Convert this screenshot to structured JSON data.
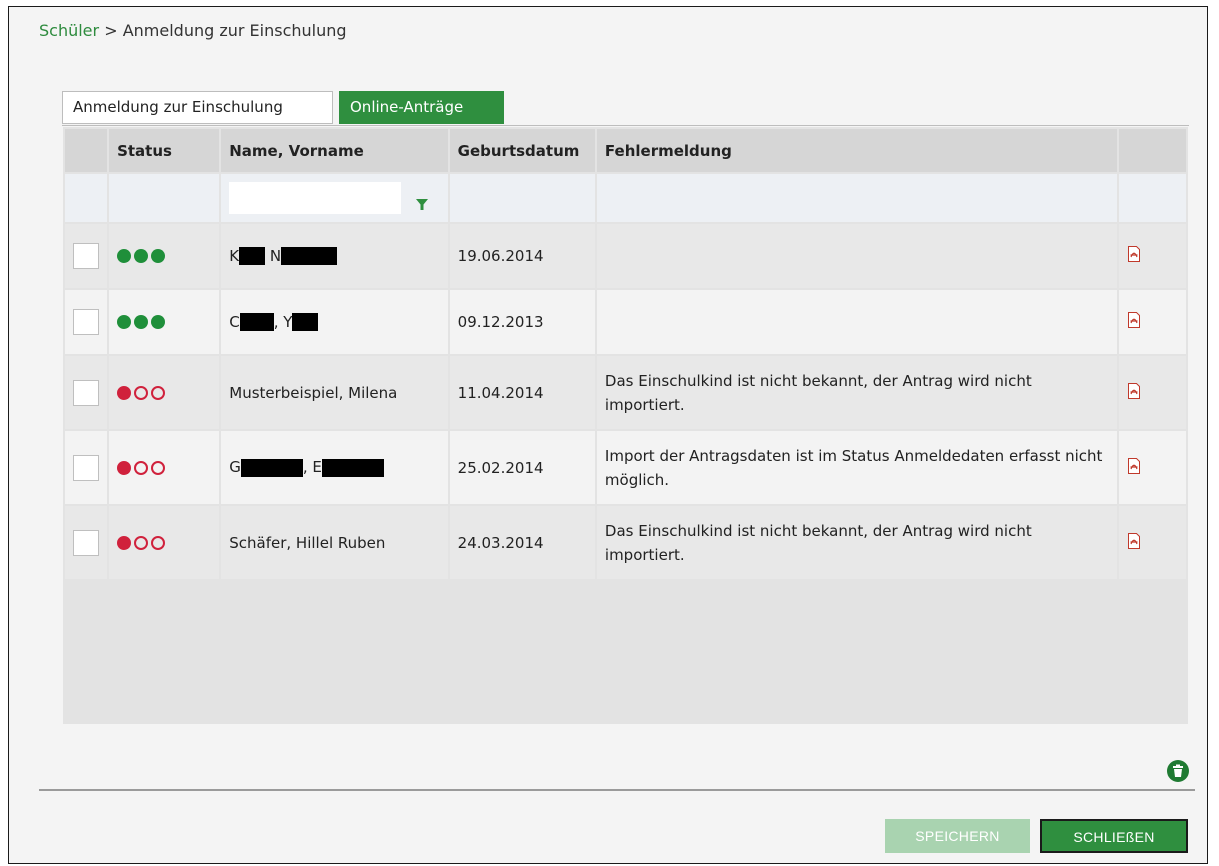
{
  "breadcrumb": {
    "link": "Schüler",
    "separator": ">",
    "current": "Anmeldung zur Einschulung"
  },
  "tabs": [
    {
      "label": "Anmeldung zur Einschulung",
      "active": false
    },
    {
      "label": "Online-Anträge",
      "active": true
    }
  ],
  "table": {
    "columns": [
      "",
      "Status",
      "Name, Vorname",
      "Geburtsdatum",
      "Fehlermeldung",
      ""
    ],
    "filter": {
      "name_value": ""
    },
    "rows": [
      {
        "status": "green",
        "name_visible": [
          "K",
          "N"
        ],
        "redacted": true,
        "birthdate": "19.06.2014",
        "error": ""
      },
      {
        "status": "green",
        "name_visible": [
          "C",
          ", Y"
        ],
        "redacted": true,
        "birthdate": "09.12.2013",
        "error": ""
      },
      {
        "status": "red",
        "name": "Musterbeispiel, Milena",
        "redacted": false,
        "birthdate": "11.04.2014",
        "error": "Das Einschulkind ist nicht bekannt, der Antrag wird nicht importiert."
      },
      {
        "status": "red",
        "name_visible": [
          "G",
          ", E"
        ],
        "redacted": true,
        "birthdate": "25.02.2014",
        "error": "Import der Antragsdaten ist im Status Anmeldedaten erfasst nicht möglich."
      },
      {
        "status": "red",
        "name": "Schäfer, Hillel Ruben",
        "redacted": false,
        "birthdate": "24.03.2014",
        "error": "Das Einschulkind ist nicht bekannt, der Antrag wird nicht importiert."
      }
    ]
  },
  "buttons": {
    "save": "SPEICHERN",
    "close": "SCHLIEßEN"
  },
  "icons": {
    "filter": "funnel-icon",
    "pdf": "pdf-icon",
    "delete": "trash-icon"
  },
  "colors": {
    "accent": "#2f8f3f",
    "status_ok": "#1f8f3a",
    "status_error": "#d0213c",
    "save_disabled": "#a9d3b0"
  }
}
